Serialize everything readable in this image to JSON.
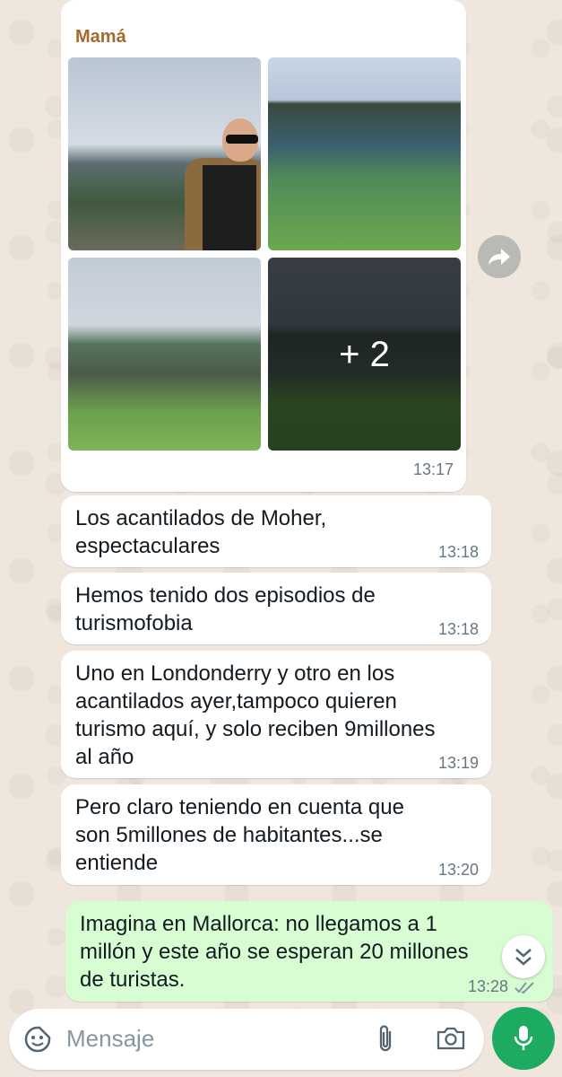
{
  "chat": {
    "messages": [
      {
        "sender": "Mamá",
        "time": "13:17",
        "more_photos": "+ 2"
      },
      {
        "text": "Los acantilados de Moher,\nespectaculares",
        "time": "13:18"
      },
      {
        "text": "Hemos tenido dos episodios de\nturismofobia",
        "time": "13:18"
      },
      {
        "text": "Uno en Londonderry y otro en los\nacantilados ayer,tampoco quieren\nturismo aquí, y solo reciben 9millones\nal año",
        "time": "13:19"
      },
      {
        "text": "Pero claro teniendo en cuenta que\nson 5millones de habitantes...se\nentiende",
        "time": "13:20"
      },
      {
        "text": "Imagina en Mallorca: no llegamos a 1\nmillón y este año se esperan 20 millones\nde turistas.",
        "time": "13:28"
      }
    ]
  },
  "composer": {
    "placeholder": "Mensaje"
  },
  "icons": {
    "forward": "forward-icon",
    "scroll_down": "chevron-double-down-icon",
    "read_receipt": "double-check-icon",
    "emoji": "sticker-icon",
    "attach": "paperclip-icon",
    "camera": "camera-icon",
    "mic": "mic-icon"
  },
  "colors": {
    "incoming_bubble": "#ffffff",
    "outgoing_bubble": "#d9fdd3",
    "sender_name": "#a5692b",
    "accent": "#1daa61"
  }
}
